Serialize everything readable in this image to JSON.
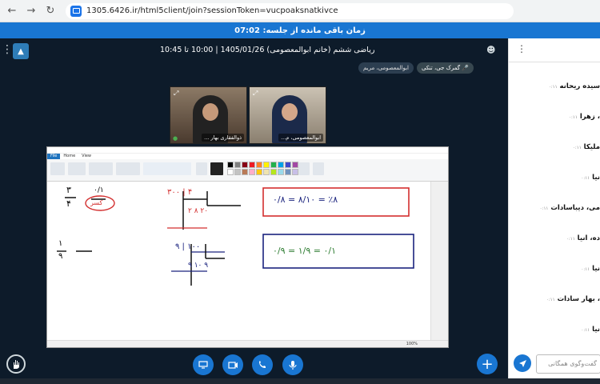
{
  "browser": {
    "url": "1305.6426.ir/html5client/join?sessionToken=vucpoaksnatkivce"
  },
  "timer": {
    "text": "زمان باقی مانده از جلسه: 07:02"
  },
  "session": {
    "title": "ریاضی ششم (خانم ابوالمعصومی) 1405/01/26 | 10:00 تا 10:45"
  },
  "chips": [
    {
      "label": "گمرک جی، تنکی"
    },
    {
      "label": "ابوالمعصومی، مریم"
    }
  ],
  "videos": [
    {
      "label": "ذوالفقاری بهار ..."
    },
    {
      "label": "ابوالمعصومی، م..."
    }
  ],
  "presentation": {
    "zoom": "100%",
    "palette": [
      "#000000",
      "#7f7f7f",
      "#880015",
      "#ed1c24",
      "#ff7f27",
      "#fff200",
      "#22b14c",
      "#00a2e8",
      "#3f48cc",
      "#a349a4",
      "#ffffff",
      "#c3c3c3",
      "#b97a57",
      "#ffaec9",
      "#ffc90e",
      "#efe4b0",
      "#b5e61d",
      "#99d9ea",
      "#7092be",
      "#c8bfe7"
    ],
    "math": {
      "p1_top": "۳",
      "p1_bot": "۴",
      "p1_r_top": "۰/۱",
      "p1_circ": "کسر",
      "p2_div": "۳۰۰ | ۴",
      "p2_rest": "۲ ۸ ۲۰",
      "p3_box_red": "۰/۸ = ۸/۱۰ = ٪۸",
      "p4_top": "۱",
      "p4_bot": "۹",
      "p5_div": "۹ | ۱۰۰",
      "p5_rest": "۹ ۱۰ ۹",
      "p6_box_blue": "۰/۹ = ۱/۹ = ۰/۱"
    }
  },
  "side": {
    "messages": [
      {
        "name": "سیده ریحانه",
        "time": "۰:۱۱"
      },
      {
        "name": "، زهرا",
        "time": "۰:۱۱"
      },
      {
        "name": "ملیکا",
        "time": "۰:۱۱"
      },
      {
        "name": "نیا",
        "time": "۰:۱۱"
      },
      {
        "name": "می، دیباسادات",
        "time": "۰:۱۱"
      },
      {
        "name": "ده، انیا",
        "time": "۰:۱۱"
      },
      {
        "name": "نیا",
        "time": "۰:۱۱"
      },
      {
        "name": "، بهار سادات",
        "time": "۰:۱۱"
      },
      {
        "name": "نیا",
        "time": "۰:۱۱"
      }
    ],
    "input_placeholder": "گفت‌وگوی همگانی"
  }
}
